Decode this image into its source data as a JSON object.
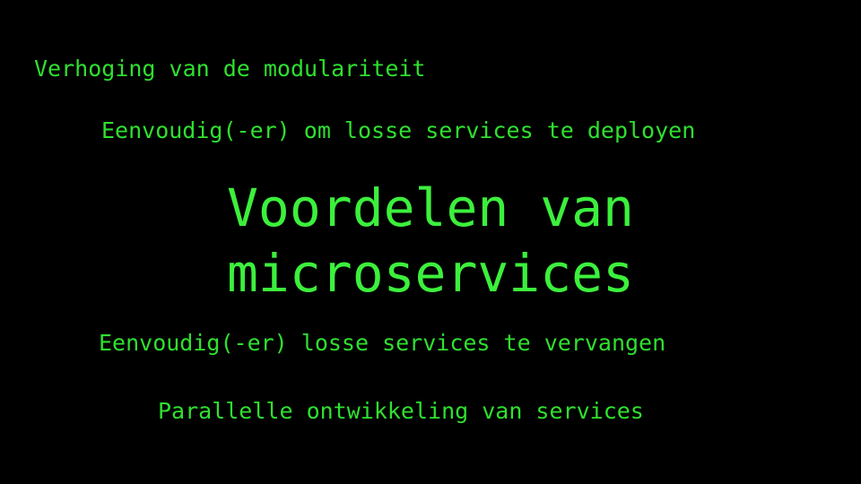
{
  "slide": {
    "background_color": "#000000",
    "text_color": "#2fe02f",
    "title_color": "#3cf03c",
    "title": "Voordelen van\nmicroservices",
    "bullets": [
      "Verhoging van de modulariteit",
      "Eenvoudig(-er) om losse services te deployen",
      "Eenvoudig(-er) losse services te vervangen",
      "Parallelle ontwikkeling van services"
    ]
  }
}
